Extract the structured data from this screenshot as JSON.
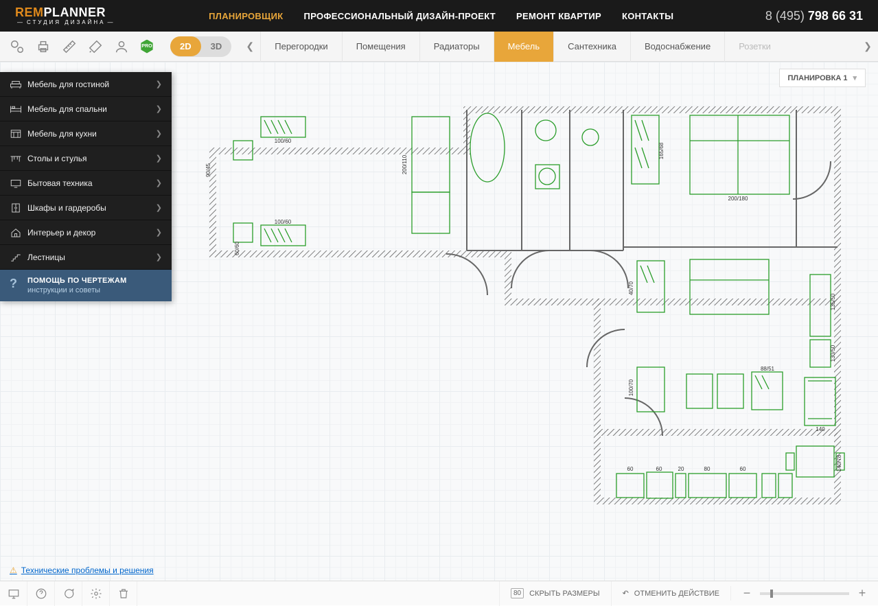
{
  "header": {
    "logo_prefix": "REM",
    "logo_suffix": "PLANNER",
    "logo_sub": "СТУДИЯ ДИЗАЙНА",
    "nav": [
      "ПЛАНИРОВЩИК",
      "ПРОФЕССИОНАЛЬНЫЙ ДИЗАЙН-ПРОЕКТ",
      "РЕМОНТ КВАРТИР",
      "КОНТАКТЫ"
    ],
    "phone_prefix": "8 (495) ",
    "phone_bold": "798 66 31"
  },
  "toolbar": {
    "pro_label": "PRO",
    "view2d": "2D",
    "view3d": "3D",
    "tabs": [
      "Перегородки",
      "Помещения",
      "Радиаторы",
      "Мебель",
      "Сантехника",
      "Водоснабжение",
      "Розетки"
    ],
    "active_tab_index": 3
  },
  "canvas": {
    "plan_selector": "ПЛАНИРОВКА 1"
  },
  "sidebar": {
    "items": [
      {
        "label": "Мебель для гостиной"
      },
      {
        "label": "Мебель для спальни"
      },
      {
        "label": "Мебель для кухни"
      },
      {
        "label": "Столы и стулья"
      },
      {
        "label": "Бытовая техника"
      },
      {
        "label": "Шкафы и гардеробы"
      },
      {
        "label": "Интерьер и декор"
      },
      {
        "label": "Лестницы"
      }
    ],
    "help_title": "ПОМОЩЬ ПО ЧЕРТЕЖАМ",
    "help_sub": "инструкции и советы"
  },
  "floorplan_labels": {
    "l1": "100/60",
    "l2": "100/60",
    "l3": "200/110",
    "l4": "90/45",
    "l5": "60/60",
    "l6": "165/68",
    "l7": "200/180",
    "l8": "40/70",
    "l9": "100/70",
    "l10": "135/50",
    "l11": "130/50",
    "l12": "88/51",
    "l13": "140",
    "l14": "60",
    "l15": "20",
    "l16": "80",
    "l17": "60",
    "l18": "140/78",
    "l19": "60"
  },
  "footer_link": "Технические проблемы и решения",
  "bottombar": {
    "hide_sizes": "СКРЫТЬ РАЗМЕРЫ",
    "undo": "ОТМЕНИТЬ ДЕЙСТВИЕ"
  }
}
